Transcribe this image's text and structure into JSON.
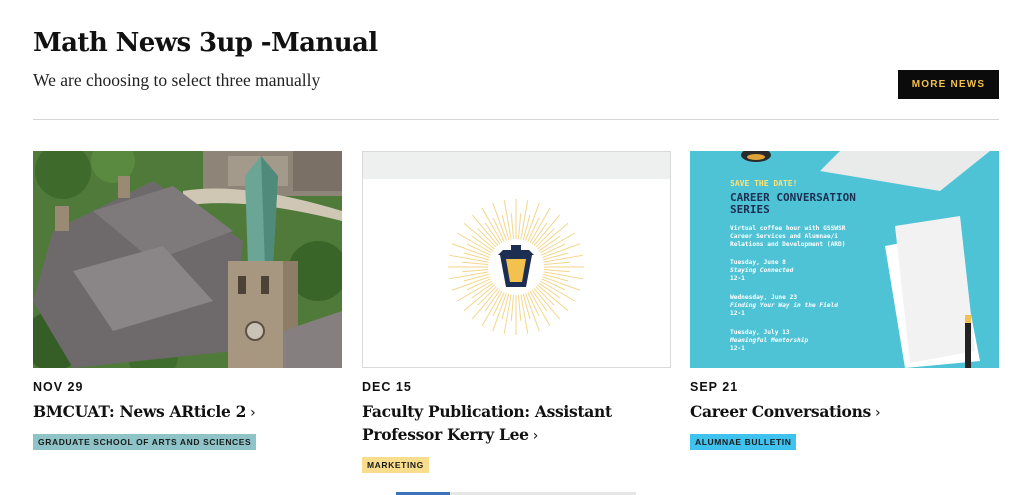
{
  "header": {
    "title": "Math News 3up -Manual",
    "subtitle": "We are choosing to select three manually",
    "more_button": "MORE NEWS"
  },
  "cards": [
    {
      "date": "NOV 29",
      "headline": "BMCUAT: News ARticle 2",
      "tag": "GRADUATE SCHOOL OF ARTS AND SCIENCES",
      "tag_color": "#8ec3c7",
      "image": "aerial-campus-photo"
    },
    {
      "date": "DEC 15",
      "headline": "Faculty Publication: Assistant Professor Kerry Lee",
      "tag": "MARKETING",
      "tag_color": "#f7dd8c",
      "image": "lantern-icon"
    },
    {
      "date": "SEP 21",
      "headline": "Career Conversations",
      "tag": "ALUMNAE BULLETIN",
      "tag_color": "#3fc2ee",
      "image": "career-conversation-flyer",
      "flyer": {
        "eyebrow": "SAVE THE DATE!",
        "title_line1": "CAREER CONVERSATION",
        "title_line2": "SERIES",
        "intro1": "Virtual coffee hour with GSSWSR",
        "intro2": "Career Services and Alumnae/i",
        "intro3": "Relations and Development (ARD)",
        "e1_date": "Tuesday, June 8",
        "e1_title": "Staying Connected",
        "e1_time": "12-1",
        "e2_date": "Wednesday, June 23",
        "e2_title": "Finding Your Way in the Field",
        "e2_time": "12-1",
        "e3_date": "Tuesday, July 13",
        "e3_title": "Meaningful Mentorship",
        "e3_time": "12-1"
      }
    }
  ],
  "colors": {
    "accent_gold": "#f2c14e",
    "button_bg": "#0b0b0b",
    "flyer_bg": "#4fc3d6"
  }
}
